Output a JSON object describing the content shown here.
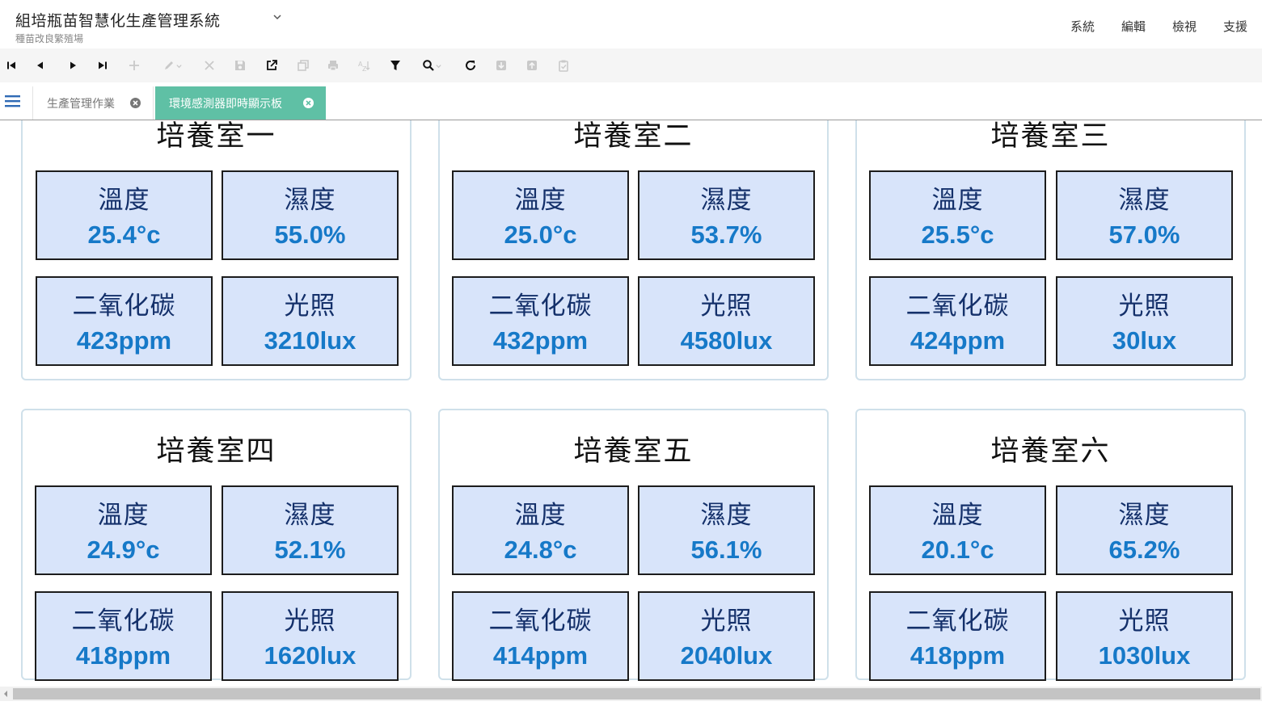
{
  "app": {
    "title": "組培瓶苗智慧化生產管理系統",
    "subtitle": "種苗改良繁殖場"
  },
  "menu": [
    "系統",
    "編輯",
    "檢視",
    "支援"
  ],
  "toolbar": {
    "buttons": [
      {
        "name": "first-record-icon",
        "enabled": true
      },
      {
        "name": "previous-record-icon",
        "enabled": true
      },
      {
        "name": "next-record-icon",
        "enabled": true
      },
      {
        "name": "last-record-icon",
        "enabled": true
      },
      {
        "name": "add-icon",
        "enabled": false
      },
      {
        "name": "edit-icon",
        "enabled": false
      },
      {
        "name": "delete-icon",
        "enabled": false
      },
      {
        "name": "save-icon",
        "enabled": false
      },
      {
        "name": "open-external-icon",
        "enabled": true
      },
      {
        "name": "copy-icon",
        "enabled": false
      },
      {
        "name": "print-icon",
        "enabled": false
      },
      {
        "name": "sort-icon",
        "enabled": false
      },
      {
        "name": "filter-icon",
        "enabled": true
      },
      {
        "name": "search-icon",
        "enabled": true
      },
      {
        "name": "refresh-icon",
        "enabled": true
      },
      {
        "name": "import-icon",
        "enabled": false
      },
      {
        "name": "export-icon",
        "enabled": false
      },
      {
        "name": "clipboard-icon",
        "enabled": false
      }
    ]
  },
  "tabs": [
    {
      "label": "生產管理作業",
      "active": false
    },
    {
      "label": "環境感測器即時顯示板",
      "active": true
    }
  ],
  "colors": {
    "active_tab": "#5fc0a5",
    "tile_background": "#d8e4fa",
    "tile_label": "#14306a",
    "tile_value": "#1679c8",
    "room_border": "#cfe0ea"
  },
  "rooms": [
    {
      "title": "培養室一",
      "sensors": [
        {
          "label": "溫度",
          "value": "25.4°c"
        },
        {
          "label": "濕度",
          "value": "55.0%"
        },
        {
          "label": "二氧化碳",
          "value": "423ppm"
        },
        {
          "label": "光照",
          "value": "3210lux"
        }
      ]
    },
    {
      "title": "培養室二",
      "sensors": [
        {
          "label": "溫度",
          "value": "25.0°c"
        },
        {
          "label": "濕度",
          "value": "53.7%"
        },
        {
          "label": "二氧化碳",
          "value": "432ppm"
        },
        {
          "label": "光照",
          "value": "4580lux"
        }
      ]
    },
    {
      "title": "培養室三",
      "sensors": [
        {
          "label": "溫度",
          "value": "25.5°c"
        },
        {
          "label": "濕度",
          "value": "57.0%"
        },
        {
          "label": "二氧化碳",
          "value": "424ppm"
        },
        {
          "label": "光照",
          "value": "30lux"
        }
      ]
    },
    {
      "title": "培養室四",
      "sensors": [
        {
          "label": "溫度",
          "value": "24.9°c"
        },
        {
          "label": "濕度",
          "value": "52.1%"
        },
        {
          "label": "二氧化碳",
          "value": "418ppm"
        },
        {
          "label": "光照",
          "value": "1620lux"
        }
      ]
    },
    {
      "title": "培養室五",
      "sensors": [
        {
          "label": "溫度",
          "value": "24.8°c"
        },
        {
          "label": "濕度",
          "value": "56.1%"
        },
        {
          "label": "二氧化碳",
          "value": "414ppm"
        },
        {
          "label": "光照",
          "value": "2040lux"
        }
      ]
    },
    {
      "title": "培養室六",
      "sensors": [
        {
          "label": "溫度",
          "value": "20.1°c"
        },
        {
          "label": "濕度",
          "value": "65.2%"
        },
        {
          "label": "二氧化碳",
          "value": "418ppm"
        },
        {
          "label": "光照",
          "value": "1030lux"
        }
      ]
    }
  ]
}
